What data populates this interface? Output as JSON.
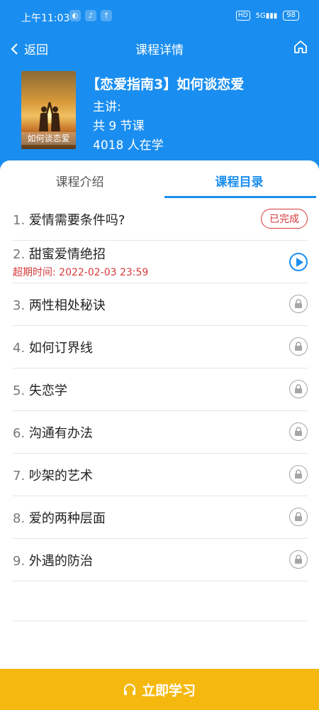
{
  "status_bar": {
    "time": "上午11:03",
    "hd": "HD",
    "signal": "5G",
    "battery": "98"
  },
  "nav": {
    "back_label": "返回",
    "title": "课程详情"
  },
  "course": {
    "cover_text": "如何谈恋爱",
    "name": "【恋爱指南3】如何谈恋爱",
    "lecturer": "主讲:",
    "lessons": "共 9 节课",
    "learners": "4018 人在学"
  },
  "tabs": [
    {
      "label": "课程介绍",
      "active": false
    },
    {
      "label": "课程目录",
      "active": true
    }
  ],
  "lessons": [
    {
      "num": "1.",
      "title": "爱情需要条件吗?",
      "status": "completed",
      "badge": "已完成"
    },
    {
      "num": "2.",
      "title": "甜蜜爱情绝招",
      "status": "playing",
      "deadline": "超期时间: 2022-02-03 23:59"
    },
    {
      "num": "3.",
      "title": "两性相处秘诀",
      "status": "locked"
    },
    {
      "num": "4.",
      "title": "如何订界线",
      "status": "locked"
    },
    {
      "num": "5.",
      "title": "失恋学",
      "status": "locked"
    },
    {
      "num": "6.",
      "title": "沟通有办法",
      "status": "locked"
    },
    {
      "num": "7.",
      "title": "吵架的艺术",
      "status": "locked"
    },
    {
      "num": "8.",
      "title": "爱的两种层面",
      "status": "locked"
    },
    {
      "num": "9.",
      "title": "外遇的防治",
      "status": "locked"
    }
  ],
  "cta": {
    "label": "立即学习",
    "icon": "headphones-icon"
  },
  "colors": {
    "primary": "#1a8ef0",
    "cta": "#f5b80f",
    "danger": "#d93a3a"
  }
}
